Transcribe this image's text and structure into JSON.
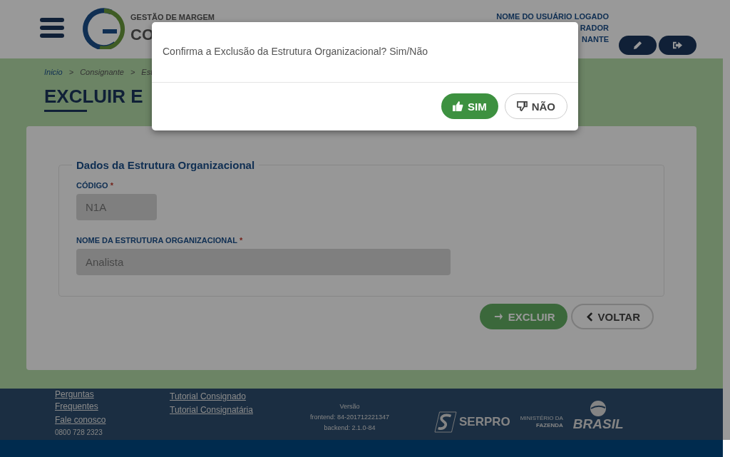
{
  "header": {
    "logo": {
      "line_1": "GESTÃO DE MARGEM",
      "line_2": "CO"
    },
    "user_lines": [
      "NOME DO USUÁRIO LOGADO",
      "RADOR",
      "NANTE"
    ],
    "buttons": [
      {
        "kind": "edit"
      },
      {
        "kind": "logout"
      }
    ]
  },
  "breadcrumb": [
    {
      "kind": "link",
      "label": "Inicio"
    },
    {
      "kind": "separator",
      "label": ">"
    },
    {
      "kind": "crumb",
      "label": "Consignante"
    },
    {
      "kind": "separator",
      "label": ">"
    },
    {
      "kind": "crumb",
      "label": "Est"
    }
  ],
  "page_title": "EXCLUIR E",
  "form": {
    "legend": "Dados da Estrutura Organizacional",
    "fields": [
      {
        "label": "CÓDIGO",
        "required_mark": "*",
        "value": "N1A",
        "disabled": true
      },
      {
        "label": "NOME DA ESTRUTURA ORGANIZACIONAL",
        "required_mark": "*",
        "value": "Analista",
        "disabled": true
      }
    ]
  },
  "actions": [
    {
      "kind": "primary",
      "label": "EXCLUIR"
    },
    {
      "kind": "secondary",
      "label": "VOLTAR"
    }
  ],
  "footer": {
    "column_1": [
      "Perguntas",
      "Frequentes",
      "Fale conosco"
    ],
    "phone": "0800 728 2323",
    "column_2": [
      "Tutorial Consignado",
      "Tutorial Consignatária"
    ],
    "version": [
      "Versão",
      "frontend: 84-201712221347",
      "backend: 2.1.0-84"
    ],
    "serpro": "SERPRO",
    "ministry": [
      "MINISTÉRIO DA",
      "FAZENDA"
    ],
    "brasil": "BRASIL"
  },
  "dialog": {
    "message": "Confirma a Exclusão da Estrutura Organizacional? Sim/Não",
    "buttons": [
      {
        "kind": "confirm",
        "label": "SIM"
      },
      {
        "kind": "cancel",
        "label": "NÃO"
      }
    ]
  }
}
